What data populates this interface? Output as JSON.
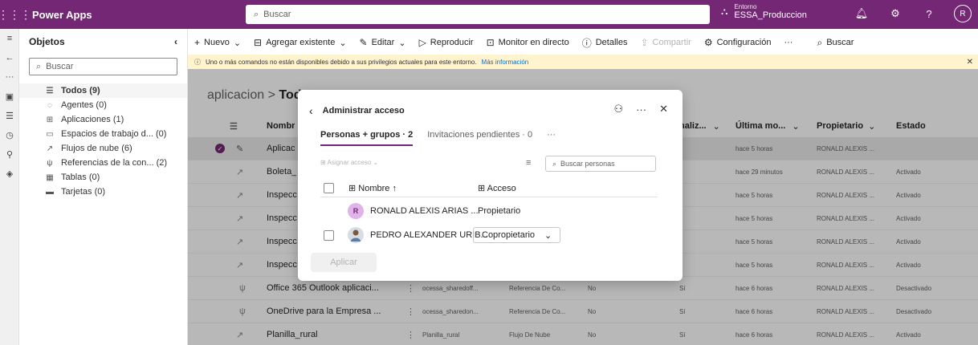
{
  "topbar": {
    "app_name": "Power Apps",
    "search_placeholder": "Buscar",
    "env_label": "Entorno",
    "env_name": "ESSA_Produccion",
    "avatar_initial": "R"
  },
  "objects": {
    "title": "Objetos",
    "search_placeholder": "Buscar",
    "items": [
      {
        "label": "Todos (9)",
        "icon": "list-icon"
      },
      {
        "label": "Agentes (0)",
        "icon": "agent-icon"
      },
      {
        "label": "Aplicaciones (1)",
        "icon": "apps-icon"
      },
      {
        "label": "Espacios de trabajo d...  (0)",
        "icon": "workspace-icon"
      },
      {
        "label": "Flujos de nube (6)",
        "icon": "flow-icon"
      },
      {
        "label": "Referencias de la con...  (2)",
        "icon": "plug-icon"
      },
      {
        "label": "Tablas (0)",
        "icon": "table-icon"
      },
      {
        "label": "Tarjetas (0)",
        "icon": "card-icon"
      }
    ]
  },
  "commandbar": {
    "nuevo": "Nuevo",
    "agregar": "Agregar existente",
    "editar": "Editar",
    "reproducir": "Reproducir",
    "monitor": "Monitor en directo",
    "detalles": "Detalles",
    "compartir": "Compartir",
    "configuracion": "Configuración",
    "more": "···",
    "buscar": "Buscar"
  },
  "infobar": {
    "message": "Uno o más comandos no están disponibles debido a sus privilegios actuales para este entorno.",
    "link": "Más información"
  },
  "breadcrumb": {
    "parent": "aplicacion",
    "separator": ">",
    "current": "Todo"
  },
  "grid": {
    "headers": {
      "name": "Nombr",
      "personaliz": "naliz...",
      "ultima": "Última mo...",
      "propietario": "Propietario",
      "estado": "Estado"
    },
    "rows": [
      {
        "name": "Aplicac",
        "col2": "",
        "col3": "",
        "col4": "",
        "col5": "",
        "modified": "hace 5 horas",
        "owner": "RONALD ALEXIS ...",
        "status": ""
      },
      {
        "name": "Boleta_",
        "col2": "",
        "col3": "",
        "col4": "",
        "col5": "",
        "modified": "hace 29 minutos",
        "owner": "RONALD ALEXIS ...",
        "status": "Activado"
      },
      {
        "name": "Inspecc",
        "col2": "",
        "col3": "",
        "col4": "",
        "col5": "",
        "modified": "hace 5 horas",
        "owner": "RONALD ALEXIS ...",
        "status": "Activado"
      },
      {
        "name": "Inspecc",
        "col2": "",
        "col3": "",
        "col4": "",
        "col5": "",
        "modified": "hace 5 horas",
        "owner": "RONALD ALEXIS ...",
        "status": "Activado"
      },
      {
        "name": "Inspecc",
        "col2": "",
        "col3": "",
        "col4": "",
        "col5": "",
        "modified": "hace 5 horas",
        "owner": "RONALD ALEXIS ...",
        "status": "Activado"
      },
      {
        "name": "Inspecc",
        "col2": "",
        "col3": "",
        "col4": "",
        "col5": "",
        "modified": "hace 5 horas",
        "owner": "RONALD ALEXIS ...",
        "status": "Activado"
      },
      {
        "name": "Office 365 Outlook aplicaci...",
        "col2": "ocessa_sharedoff...",
        "col3": "Referencia De Co...",
        "col4": "No",
        "col5": "Sí",
        "modified": "hace 6 horas",
        "owner": "RONALD ALEXIS ...",
        "status": "Desactivado"
      },
      {
        "name": "OneDrive para la Empresa ...",
        "col2": "ocessa_sharedon...",
        "col3": "Referencia De Co...",
        "col4": "No",
        "col5": "Sí",
        "modified": "hace 6 horas",
        "owner": "RONALD ALEXIS ...",
        "status": "Desactivado"
      },
      {
        "name": "Planilla_rural",
        "col2": "Planilla_rural",
        "col3": "Flujo De Nube",
        "col4": "No",
        "col5": "Sí",
        "modified": "hace 6 horas",
        "owner": "RONALD ALEXIS ...",
        "status": "Activado"
      }
    ]
  },
  "dialog": {
    "title": "Administrar acceso",
    "tabs": [
      "Personas + grupos · 2",
      "Invitaciones pendientes · 0"
    ],
    "tab_more": "···",
    "assign": "Asignar acceso",
    "search_placeholder": "Buscar personas",
    "col_name": "Nombre ↑",
    "col_access": "Acceso",
    "people": [
      {
        "initial": "R",
        "name": "RONALD ALEXIS ARIAS ...",
        "access": "Propietario"
      },
      {
        "initial": "",
        "name": "PEDRO ALEXANDER URIB...",
        "access": "Copropietario"
      }
    ],
    "apply": "Aplicar"
  }
}
